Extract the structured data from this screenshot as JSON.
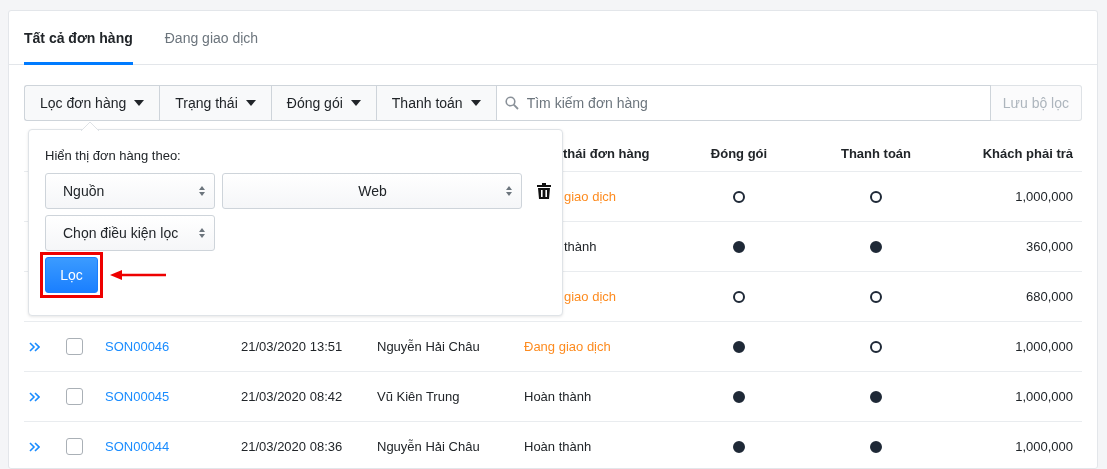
{
  "tabs": [
    {
      "label": "Tất cả đơn hàng",
      "selected": true
    },
    {
      "label": "Đang giao dịch",
      "selected": false
    }
  ],
  "filter_bar": {
    "dropdowns": [
      "Lọc đơn hàng",
      "Trạng thái",
      "Đóng gói",
      "Thanh toán"
    ],
    "search": {
      "placeholder": "Tìm kiếm đơn hàng"
    },
    "save_button": "Lưu bộ lọc"
  },
  "filter_popup": {
    "label": "Hiển thị đơn hàng theo:",
    "field_select": "Nguồn",
    "value_select": "Web",
    "condition_select": "Chọn điều kiện lọc",
    "apply_button": "Lọc"
  },
  "table": {
    "columns": [
      "thái đơn hàng",
      "Đóng gói",
      "Thanh toán",
      "Khách phải trả"
    ],
    "rows": [
      {
        "status": {
          "text": "giao dịch",
          "color": "#fd8b1f"
        },
        "packed": false,
        "paid": false,
        "total": "1,000,000"
      },
      {
        "status": {
          "text": "thành",
          "color": "#212529"
        },
        "packed": true,
        "paid": true,
        "total": "360,000"
      },
      {
        "status": {
          "text": "giao dịch",
          "color": "#fd8b1f"
        },
        "packed": false,
        "paid": false,
        "total": "680,000"
      },
      {
        "checked": false,
        "code": "SON00046",
        "date": "21/03/2020 13:51",
        "customer": "Nguyễn Hải Châu",
        "status": {
          "text": "Đang giao dịch",
          "color": "#fd8b1f"
        },
        "packed": true,
        "paid": false,
        "total": "1,000,000"
      },
      {
        "checked": false,
        "code": "SON00045",
        "date": "21/03/2020 08:42",
        "customer": "Vũ Kiên Trung",
        "status": {
          "text": "Hoàn thành",
          "color": "#212529"
        },
        "packed": true,
        "paid": true,
        "total": "1,000,000"
      },
      {
        "checked": false,
        "code": "SON00044",
        "date": "21/03/2020 08:36",
        "customer": "Nguyễn Hải Châu",
        "status": {
          "text": "Hoàn thành",
          "color": "#212529"
        },
        "packed": true,
        "paid": true,
        "total": "1,000,000"
      }
    ]
  }
}
